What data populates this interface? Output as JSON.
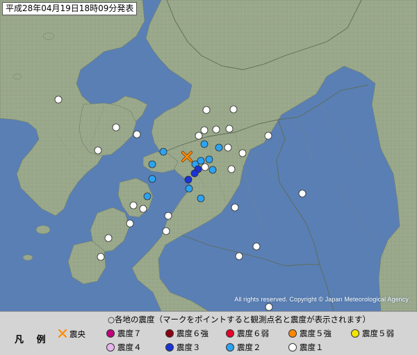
{
  "header": {
    "issue_time": "平成28年04月19日18時09分発表"
  },
  "copyright": "All rights reserved. Copyright © Japan Meteorological Agency",
  "legend": {
    "title": "凡 例",
    "heading": "○各地の震度（マークをポイントすると観測点名と震度が表示されます）",
    "epicenter_label": "震央",
    "items": [
      {
        "label": "震度７",
        "color": "#c0007c"
      },
      {
        "label": "震度６強",
        "color": "#8b0010"
      },
      {
        "label": "震度６弱",
        "color": "#e8002a"
      },
      {
        "label": "震度５強",
        "color": "#ff8800"
      },
      {
        "label": "震度５弱",
        "color": "#f2e600"
      },
      {
        "label": "震度４",
        "color": "#e8b4ee"
      },
      {
        "label": "震度３",
        "color": "#1a34d6"
      },
      {
        "label": "震度２",
        "color": "#2ca3f2"
      },
      {
        "label": "震度１",
        "color": "#ffffff"
      }
    ]
  },
  "colors": {
    "sea": "#5a7fb4",
    "land": "#9aa88a",
    "epicenter": "#ff8c00"
  },
  "map_features": {
    "epicenter_icon": "x-mark-icon",
    "station_icon": "circle-icon"
  }
}
